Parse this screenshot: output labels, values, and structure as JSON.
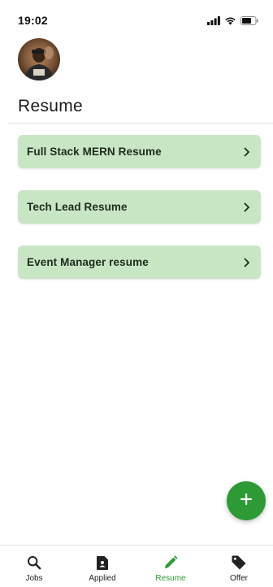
{
  "status_bar": {
    "time": "19:02",
    "icons": [
      "signal-icon",
      "wifi-icon",
      "battery-icon"
    ]
  },
  "header": {
    "avatar_icon": "avatar",
    "title": "Resume"
  },
  "resumes": [
    {
      "label": "Full Stack MERN Resume"
    },
    {
      "label": "Tech Lead Resume"
    },
    {
      "label": "Event Manager resume"
    }
  ],
  "fab": {
    "icon": "plus-icon"
  },
  "bottom_nav": {
    "active_index": 2,
    "items": [
      {
        "label": "Jobs",
        "icon": "search-icon"
      },
      {
        "label": "Applied",
        "icon": "document-icon"
      },
      {
        "label": "Resume",
        "icon": "pencil-icon"
      },
      {
        "label": "Offer",
        "icon": "tag-icon"
      }
    ]
  },
  "colors": {
    "accent": "#2e9a36",
    "card_background": "#c8e6c4",
    "text": "#1f1f1f"
  }
}
